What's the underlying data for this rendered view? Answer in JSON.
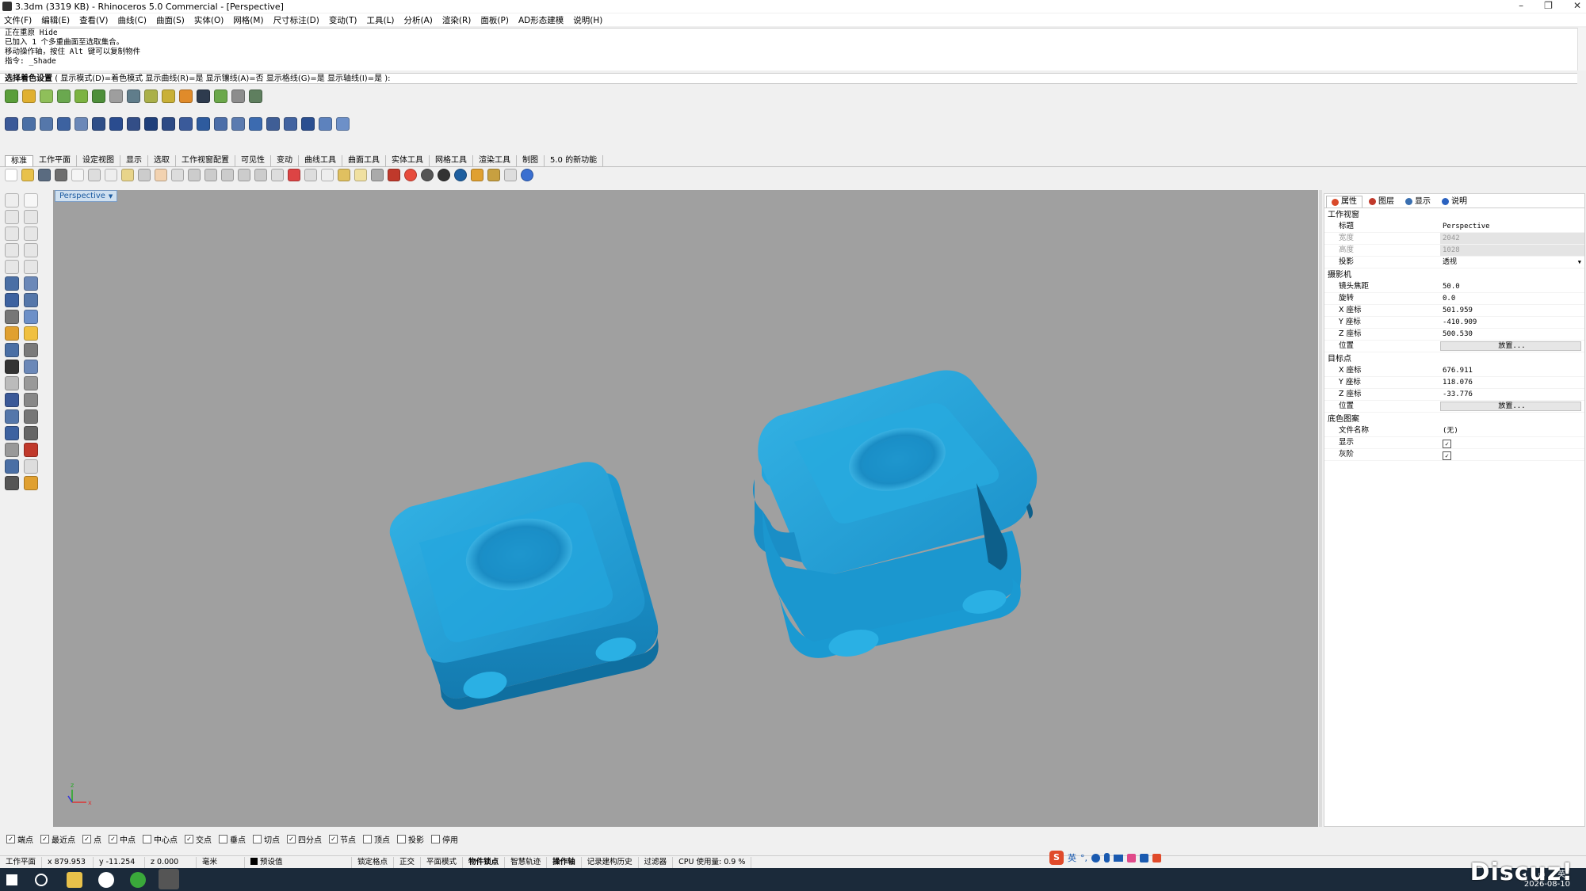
{
  "window": {
    "title": "3.3dm (3319 KB) - Rhinoceros 5.0 Commercial - [Perspective]"
  },
  "menu": [
    "文件(F)",
    "编辑(E)",
    "查看(V)",
    "曲线(C)",
    "曲面(S)",
    "实体(O)",
    "网格(M)",
    "尺寸标注(D)",
    "变动(T)",
    "工具(L)",
    "分析(A)",
    "渲染(R)",
    "面板(P)",
    "AD形态建模",
    "说明(H)"
  ],
  "command": {
    "history": [
      "正在重原 Hide",
      "已加入 1 个多重曲面至选取集合。",
      "移动操作轴，按住 Alt 键可以复制物件",
      "指令: _Shade"
    ],
    "prompt_label": "选择着色设置",
    "prompt_options": "( 显示模式(D)=着色模式  显示曲线(R)=是  显示镶线(A)=否  显示格线(G)=是  显示轴线(I)=是 ):"
  },
  "tabs": [
    "标准",
    "工作平面",
    "设定视图",
    "显示",
    "选取",
    "工作视窗配置",
    "可见性",
    "变动",
    "曲线工具",
    "曲面工具",
    "实体工具",
    "网格工具",
    "渲染工具",
    "制图",
    "5.0 的新功能"
  ],
  "viewport": {
    "label": "Perspective",
    "menu_arrow": "▼"
  },
  "panel": {
    "tabs": [
      {
        "label": "属性",
        "color": "#d94a2a"
      },
      {
        "label": "图层",
        "color": "#c0392b"
      },
      {
        "label": "显示",
        "color": "#3a6fb0"
      },
      {
        "label": "说明",
        "color": "#2b62c0"
      }
    ],
    "sections": {
      "viewport": "工作视窗",
      "camera": "摄影机",
      "target": "目标点",
      "wallpaper": "底色图案"
    },
    "viewport_rows": [
      {
        "k": "标题",
        "v": "Perspective"
      },
      {
        "k": "宽度",
        "v": "2042"
      },
      {
        "k": "高度",
        "v": "1028"
      },
      {
        "k": "投影",
        "v": "透视"
      }
    ],
    "camera_rows": [
      {
        "k": "镜头焦距",
        "v": "50.0"
      },
      {
        "k": "旋转",
        "v": "0.0"
      },
      {
        "k": "X 座标",
        "v": "501.959"
      },
      {
        "k": "Y 座标",
        "v": "-410.909"
      },
      {
        "k": "Z 座标",
        "v": "500.530"
      },
      {
        "k": "位置",
        "v": "放置..."
      }
    ],
    "target_rows": [
      {
        "k": "X 座标",
        "v": "676.911"
      },
      {
        "k": "Y 座标",
        "v": "118.076"
      },
      {
        "k": "Z 座标",
        "v": "-33.776"
      },
      {
        "k": "位置",
        "v": "放置..."
      }
    ],
    "wallpaper_rows": [
      {
        "k": "文件名称",
        "v": "(无)"
      },
      {
        "k": "显示",
        "v": "✓"
      },
      {
        "k": "灰阶",
        "v": "✓"
      }
    ]
  },
  "osnap": [
    {
      "label": "端点",
      "checked": true
    },
    {
      "label": "最近点",
      "checked": true
    },
    {
      "label": "点",
      "checked": true
    },
    {
      "label": "中点",
      "checked": true
    },
    {
      "label": "中心点",
      "checked": false
    },
    {
      "label": "交点",
      "checked": true
    },
    {
      "label": "垂点",
      "checked": false
    },
    {
      "label": "切点",
      "checked": false
    },
    {
      "label": "四分点",
      "checked": true
    },
    {
      "label": "节点",
      "checked": true
    },
    {
      "label": "顶点",
      "checked": false
    },
    {
      "label": "投影",
      "checked": false
    },
    {
      "label": "停用",
      "checked": false
    }
  ],
  "status": {
    "cplane": "工作平面",
    "x": "x 879.953",
    "y": "y -11.254",
    "z": "z 0.000",
    "units": "毫米",
    "layer": "预设值",
    "items": [
      "锁定格点",
      "正交",
      "平面模式",
      "物件锁点",
      "智慧轨迹",
      "操作轴",
      "记录建构历史",
      "过滤器",
      "CPU 使用量: 0.9 %"
    ]
  },
  "ime": {
    "lang": "英"
  },
  "taskbar": {
    "date": "2026-08-10"
  },
  "watermark": "Discuz!",
  "colors": {
    "viewport_bg": "#a0a0a0",
    "model": "#1e9fd6",
    "accent": "#3a6fb0"
  }
}
